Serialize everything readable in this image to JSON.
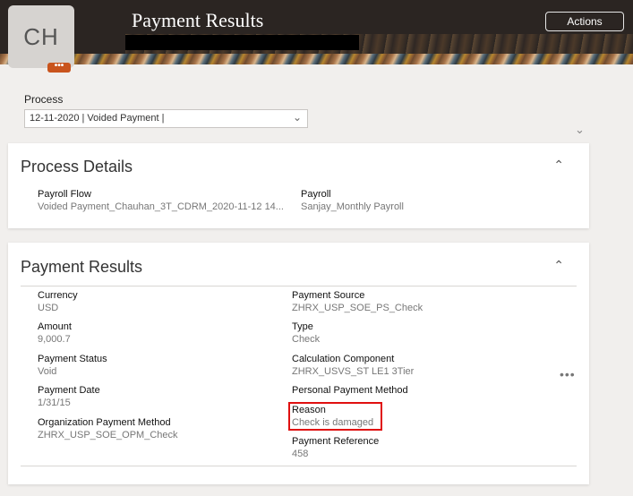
{
  "header": {
    "avatar_initials": "CH",
    "avatar_more": "•••",
    "title": "Payment Results",
    "actions_label": "Actions"
  },
  "process": {
    "label": "Process",
    "selected": "12-11-2020 | Voided Payment |"
  },
  "process_details": {
    "title": "Process Details",
    "fields": {
      "payroll_flow": {
        "label": "Payroll Flow",
        "value": "Voided Payment_Chauhan_3T_CDRM_2020-11-12 14..."
      },
      "payroll": {
        "label": "Payroll",
        "value": "Sanjay_Monthly Payroll"
      }
    }
  },
  "payment_results": {
    "title": "Payment Results",
    "left": {
      "currency": {
        "label": "Currency",
        "value": "USD"
      },
      "amount": {
        "label": "Amount",
        "value": "9,000.7"
      },
      "payment_status": {
        "label": "Payment Status",
        "value": "Void"
      },
      "payment_date": {
        "label": "Payment Date",
        "value": "1/31/15"
      },
      "org_payment_method": {
        "label": "Organization Payment Method",
        "value": "ZHRX_USP_SOE_OPM_Check"
      }
    },
    "right": {
      "payment_source": {
        "label": "Payment Source",
        "value": "ZHRX_USP_SOE_PS_Check"
      },
      "type": {
        "label": "Type",
        "value": "Check"
      },
      "calc_component": {
        "label": "Calculation Component",
        "value": "ZHRX_USVS_ST LE1 3Tier"
      },
      "personal_payment_method": {
        "label": "Personal Payment Method",
        "value": ""
      },
      "reason": {
        "label": "Reason",
        "value": "Check is damaged"
      },
      "payment_reference": {
        "label": "Payment Reference",
        "value": "458"
      }
    },
    "more_icon": "•••"
  },
  "colors": {
    "header_bg": "#2b2522",
    "highlight": "#e01010",
    "avatar_badge": "#c9541d"
  }
}
